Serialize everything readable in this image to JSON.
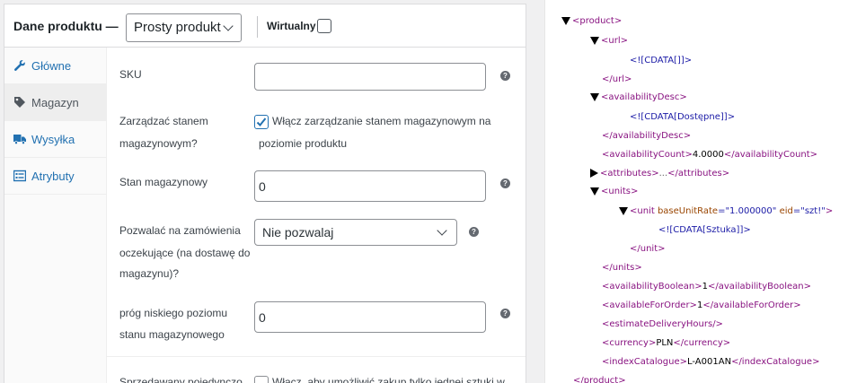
{
  "panel": {
    "title": "Dane produktu —",
    "product_type": "Prosty produkt",
    "virtual_label": "Wirtualny"
  },
  "tabs": [
    {
      "label": "Główne",
      "icon": "wrench-icon"
    },
    {
      "label": "Magazyn",
      "icon": "tag-icon"
    },
    {
      "label": "Wysyłka",
      "icon": "truck-icon"
    },
    {
      "label": "Atrybuty",
      "icon": "list-icon"
    }
  ],
  "form": {
    "sku_label": "SKU",
    "sku_value": "",
    "manage_label_1": "Zarządzać stanem",
    "manage_label_2": "magazynowym?",
    "manage_check_1": "Włącz zarządzanie stanem magazynowym na",
    "manage_check_2": "poziomie produktu",
    "stock_label": "Stan magazynowy",
    "stock_value": "0",
    "backorder_label_1": "Pozwalać na zamówienia",
    "backorder_label_2": "oczekujące (na dostawę do",
    "backorder_label_3": "magazynu)?",
    "backorder_value": "Nie pozwalaj",
    "low_label_1": "próg niskiego poziomu",
    "low_label_2": "stanu magazynowego",
    "low_value": "0",
    "sold_label": "Sprzedawany pojedynczo",
    "sold_check": "Włącz, aby umożliwić zakup tylko jednej sztuki w"
  },
  "help_glyph": "?",
  "xml": {
    "l1": "<product>",
    "l2": "<url>",
    "l3": "<![CDATA[]]>",
    "l4": "</url>",
    "l5": "<availabilityDesc>",
    "l6a": "<![CDATA[",
    "l6b": "Dostępne",
    "l6c": "]]>",
    "l7": "</availabilityDesc>",
    "l8a": "<availabilityCount>",
    "l8b": "4.0000",
    "l8c": "</availabilityCount>",
    "l9a": "<attributes>",
    "l9b": "...",
    "l9c": "</attributes>",
    "l10": "<units>",
    "l11a": "<unit",
    "l11b": "baseUnitRate",
    "l11c": "=\"1.000000\"",
    "l11d": "eid",
    "l11e": "=\"szt!\"",
    "l11f": ">",
    "l12a": "<![CDATA[",
    "l12b": "Sztuka",
    "l12c": "]]>",
    "l13": "</unit>",
    "l14": "</units>",
    "l15a": "<availabilityBoolean>",
    "l15b": "1",
    "l15c": "</availabilityBoolean>",
    "l16a": "<availableForOrder>",
    "l16b": "1",
    "l16c": "</availableForOrder>",
    "l17": "<estimateDeliveryHours/>",
    "l18a": "<currency>",
    "l18b": "PLN",
    "l18c": "</currency>",
    "l19a": "<indexCatalogue>",
    "l19b": "L-A001AN",
    "l19c": "</indexCatalogue>",
    "l20": "</product>"
  },
  "colors": {
    "link": "#2271b1",
    "xml_tag": "#881280",
    "xml_text": "#1a1aa6",
    "xml_attr": "#994500",
    "check": "#2271b1"
  }
}
